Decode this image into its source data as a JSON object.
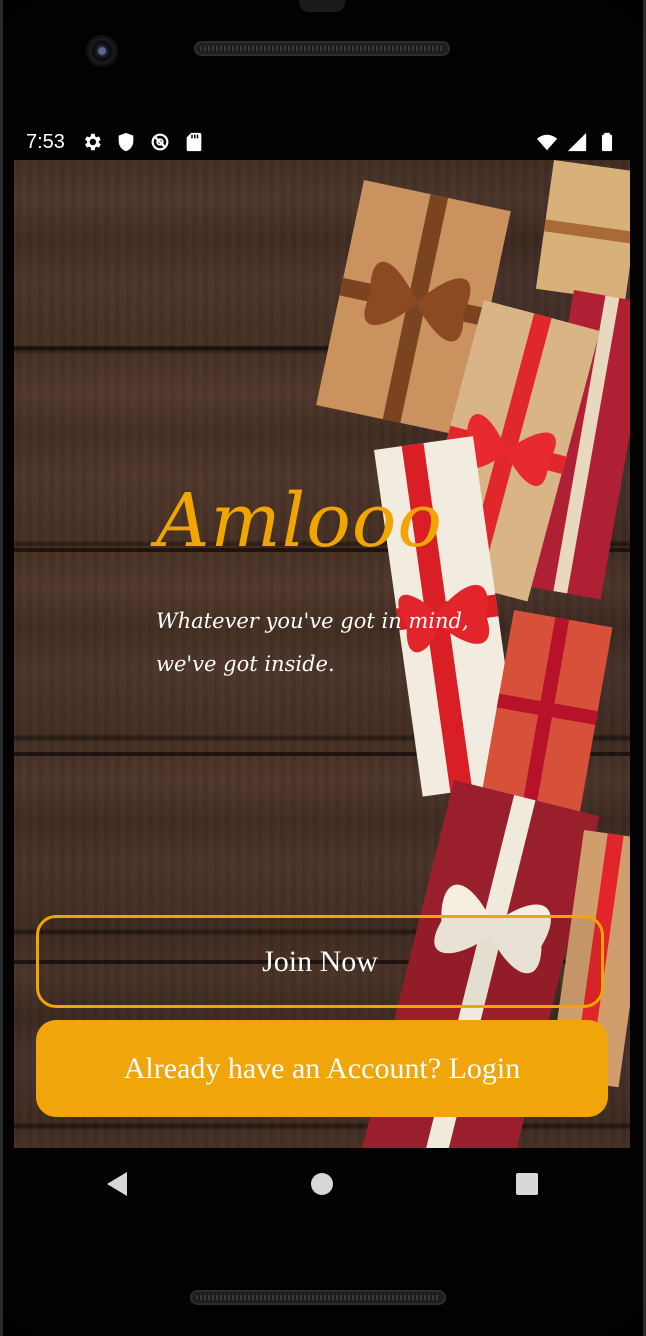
{
  "status_bar": {
    "time": "7:53",
    "left_icons": [
      "settings-icon",
      "shield-icon",
      "no-sync-icon",
      "sd-card-icon"
    ],
    "right_icons": [
      "wifi-icon",
      "signal-icon",
      "battery-icon"
    ]
  },
  "app": {
    "brand": "Amlooo",
    "tagline_line1": "Whatever you've got in mind,",
    "tagline_line2": "we've got inside.",
    "join_label": "Join Now",
    "login_label": "Already have an Account? Login"
  },
  "nav": {
    "back_icon": "back-triangle-icon",
    "home_icon": "home-circle-icon",
    "recents_icon": "recents-square-icon"
  },
  "colors": {
    "accent": "#f0a500",
    "login_bg": "#f0a50b",
    "wood": "#3f2c23"
  }
}
